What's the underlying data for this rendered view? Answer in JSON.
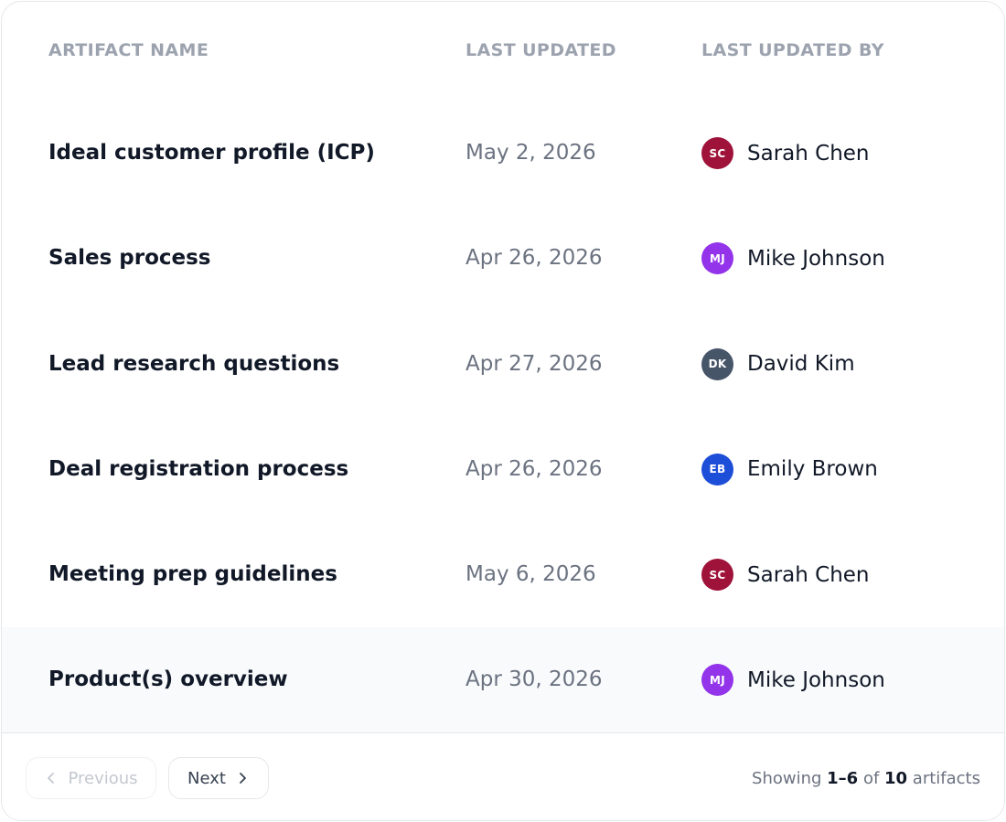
{
  "table": {
    "columns": {
      "name": "ARTIFACT NAME",
      "updated": "LAST UPDATED",
      "updated_by": "LAST UPDATED BY"
    },
    "rows": [
      {
        "name": "Ideal customer profile (ICP)",
        "date": "May 2, 2026",
        "initials": "SC",
        "person": "Sarah Chen",
        "avatar_color": "#9f1239"
      },
      {
        "name": "Sales process",
        "date": "Apr 26, 2026",
        "initials": "MJ",
        "person": "Mike Johnson",
        "avatar_color": "#9333ea"
      },
      {
        "name": "Lead research questions",
        "date": "Apr 27, 2026",
        "initials": "DK",
        "person": "David Kim",
        "avatar_color": "#475569"
      },
      {
        "name": "Deal registration process",
        "date": "Apr 26, 2026",
        "initials": "EB",
        "person": "Emily Brown",
        "avatar_color": "#1d4ed8"
      },
      {
        "name": "Meeting prep guidelines",
        "date": "May 6, 2026",
        "initials": "SC",
        "person": "Sarah Chen",
        "avatar_color": "#9f1239"
      },
      {
        "name": "Product(s) overview",
        "date": "Apr 30, 2026",
        "initials": "MJ",
        "person": "Mike Johnson",
        "avatar_color": "#9333ea"
      }
    ]
  },
  "pagination": {
    "previous_label": "Previous",
    "next_label": "Next",
    "showing_prefix": "Showing ",
    "range": "1–6",
    "of_text": " of ",
    "total": "10",
    "suffix": " artifacts"
  },
  "icons": {
    "previous": "chevron-left-icon",
    "next": "chevron-right-icon"
  }
}
